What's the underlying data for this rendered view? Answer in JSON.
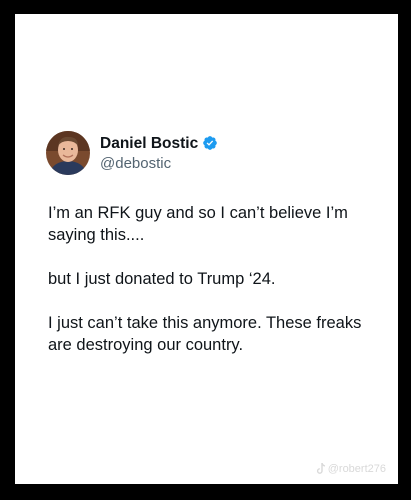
{
  "tweet": {
    "display_name": "Daniel Bostic",
    "handle": "@debostic",
    "verified_icon": "verified-badge-icon",
    "avatar_icon": "avatar",
    "paragraphs": [
      "I’m an RFK guy and so I can’t believe I’m saying this....",
      "but I just donated to Trump ‘24.",
      "I just can’t take this anymore. These freaks are destroying our country."
    ]
  },
  "watermark": {
    "icon": "tiktok-icon",
    "text": "@robert276"
  },
  "colors": {
    "page_background": "#000000",
    "card_background": "#ffffff",
    "text_primary": "#0f1419",
    "text_secondary": "#536471",
    "verified_blue": "#1d9bf0"
  }
}
